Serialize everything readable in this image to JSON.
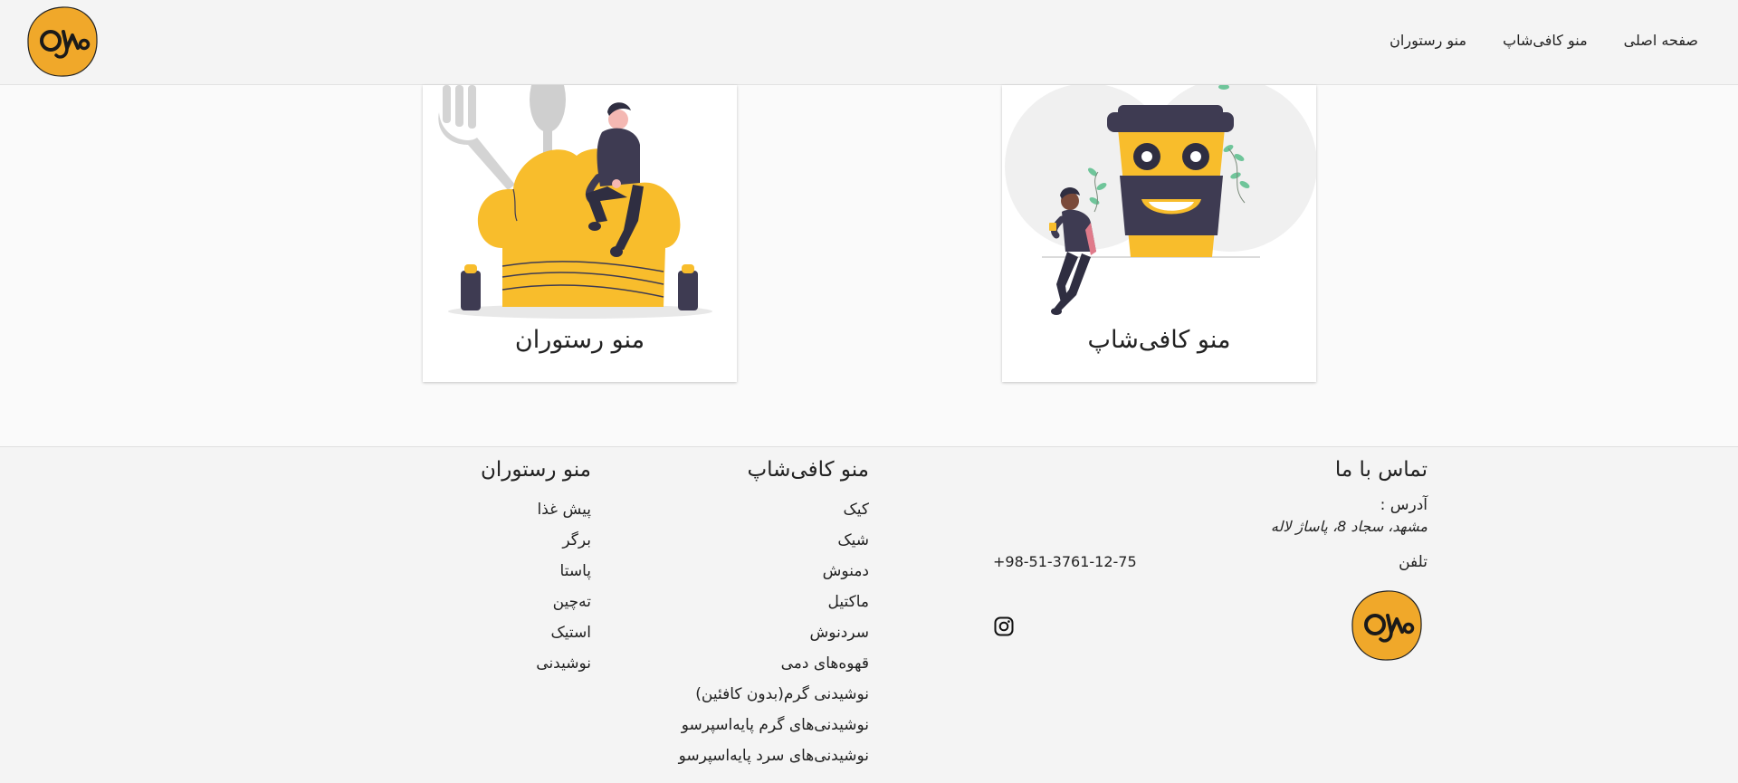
{
  "header": {
    "nav": [
      {
        "label": "صفحه اصلی"
      },
      {
        "label": "منو کافی‌شاپ"
      },
      {
        "label": "منو رستوران"
      }
    ],
    "logo_icon": "brand-logo-icon",
    "brand_color": "#f0a82a"
  },
  "cards": [
    {
      "title": "منو رستوران",
      "icon": "chef-hat-illustration"
    },
    {
      "title": "منو کافی‌شاپ",
      "icon": "coffee-cup-illustration"
    }
  ],
  "footer": {
    "contact": {
      "title": "تماس با ما",
      "address_label": "آدرس :",
      "address_value": "مشهد، سجاد 8، پاساژ لاله",
      "phone_label": "تلفن",
      "phone_value": "+98-51-3761-12-75",
      "social_icon": "instagram-icon"
    },
    "cafe_menu": {
      "title": "منو کافی‌شاپ",
      "items": [
        "کیک",
        "شیک",
        "دمنوش",
        "ماکتیل",
        "سردنوش",
        "قهوه‌های دمی",
        "نوشیدنی گرم(بدون کافئین)",
        "نوشیدنی‌های گرم پایه‌اسپرسو",
        "نوشیدنی‌های سرد پایه‌اسپرسو"
      ]
    },
    "restaurant_menu": {
      "title": "منو رستوران",
      "items": [
        "پیش غذا",
        "برگر",
        "پاستا",
        "ته‌چین",
        "استیک",
        "نوشیدنی"
      ]
    }
  }
}
